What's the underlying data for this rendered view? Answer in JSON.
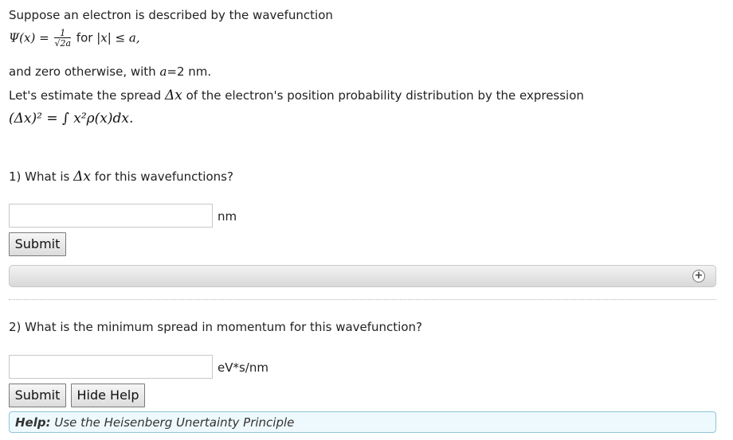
{
  "intro": {
    "line1": "Suppose an electron is described by the wavefunction",
    "wavefunction": {
      "lhs": "Ψ(x) =",
      "num": "1",
      "den": "√2a",
      "condition_text": "for",
      "condition_math": "|x| ≤ a,"
    },
    "line3": "and zero otherwise, with",
    "a_symbol": "a",
    "a_value": "=2 nm.",
    "line4_pre": "Let's estimate the spread",
    "delta_x": "Δx",
    "line4_post": "of the electron's position probability distribution by the expression",
    "expression": "(Δx)² = ∫ x²ρ(x)dx."
  },
  "q1": {
    "pre": "1) What is",
    "symbol": "Δx",
    "post": "for this wavefunctions?",
    "input_value": "",
    "unit": "nm",
    "submit_label": "Submit"
  },
  "q2": {
    "text": "2) What is the minimum spread in momentum for this wavefunction?",
    "input_value": "",
    "unit": "eV*s/nm",
    "submit_label": "Submit",
    "hide_help_label": "Hide Help",
    "help_label": "Help:",
    "help_text": "Use the Heisenberg Unertainty Principle"
  },
  "expand_icon": "plus-circle-icon"
}
